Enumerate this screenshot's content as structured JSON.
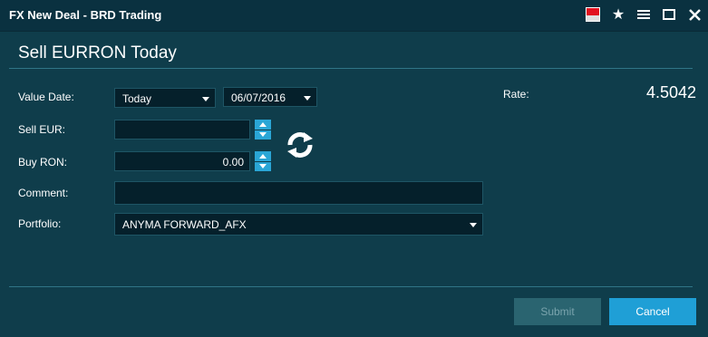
{
  "window": {
    "title": "FX New Deal - BRD Trading",
    "controls": [
      "flag-icon",
      "star-icon",
      "menu-icon",
      "maximize-icon",
      "close-icon"
    ]
  },
  "heading": "Sell EURRON Today",
  "form": {
    "value_date_label": "Value Date:",
    "value_date_tenor": "Today",
    "value_date_date": "06/07/2016",
    "sell_label": "Sell EUR:",
    "sell_value": "",
    "buy_label": "Buy RON:",
    "buy_value": "0.00",
    "comment_label": "Comment:",
    "comment_value": "",
    "portfolio_label": "Portfolio:",
    "portfolio_value": "ANYMA FORWARD_AFX"
  },
  "rate": {
    "label": "Rate:",
    "value": "4.5042"
  },
  "buttons": {
    "submit": "Submit",
    "cancel": "Cancel"
  },
  "colors": {
    "background": "#0f3d4b",
    "titlebar": "#0a3140",
    "accent": "#1f9fd6",
    "input_bg": "#05202b"
  }
}
